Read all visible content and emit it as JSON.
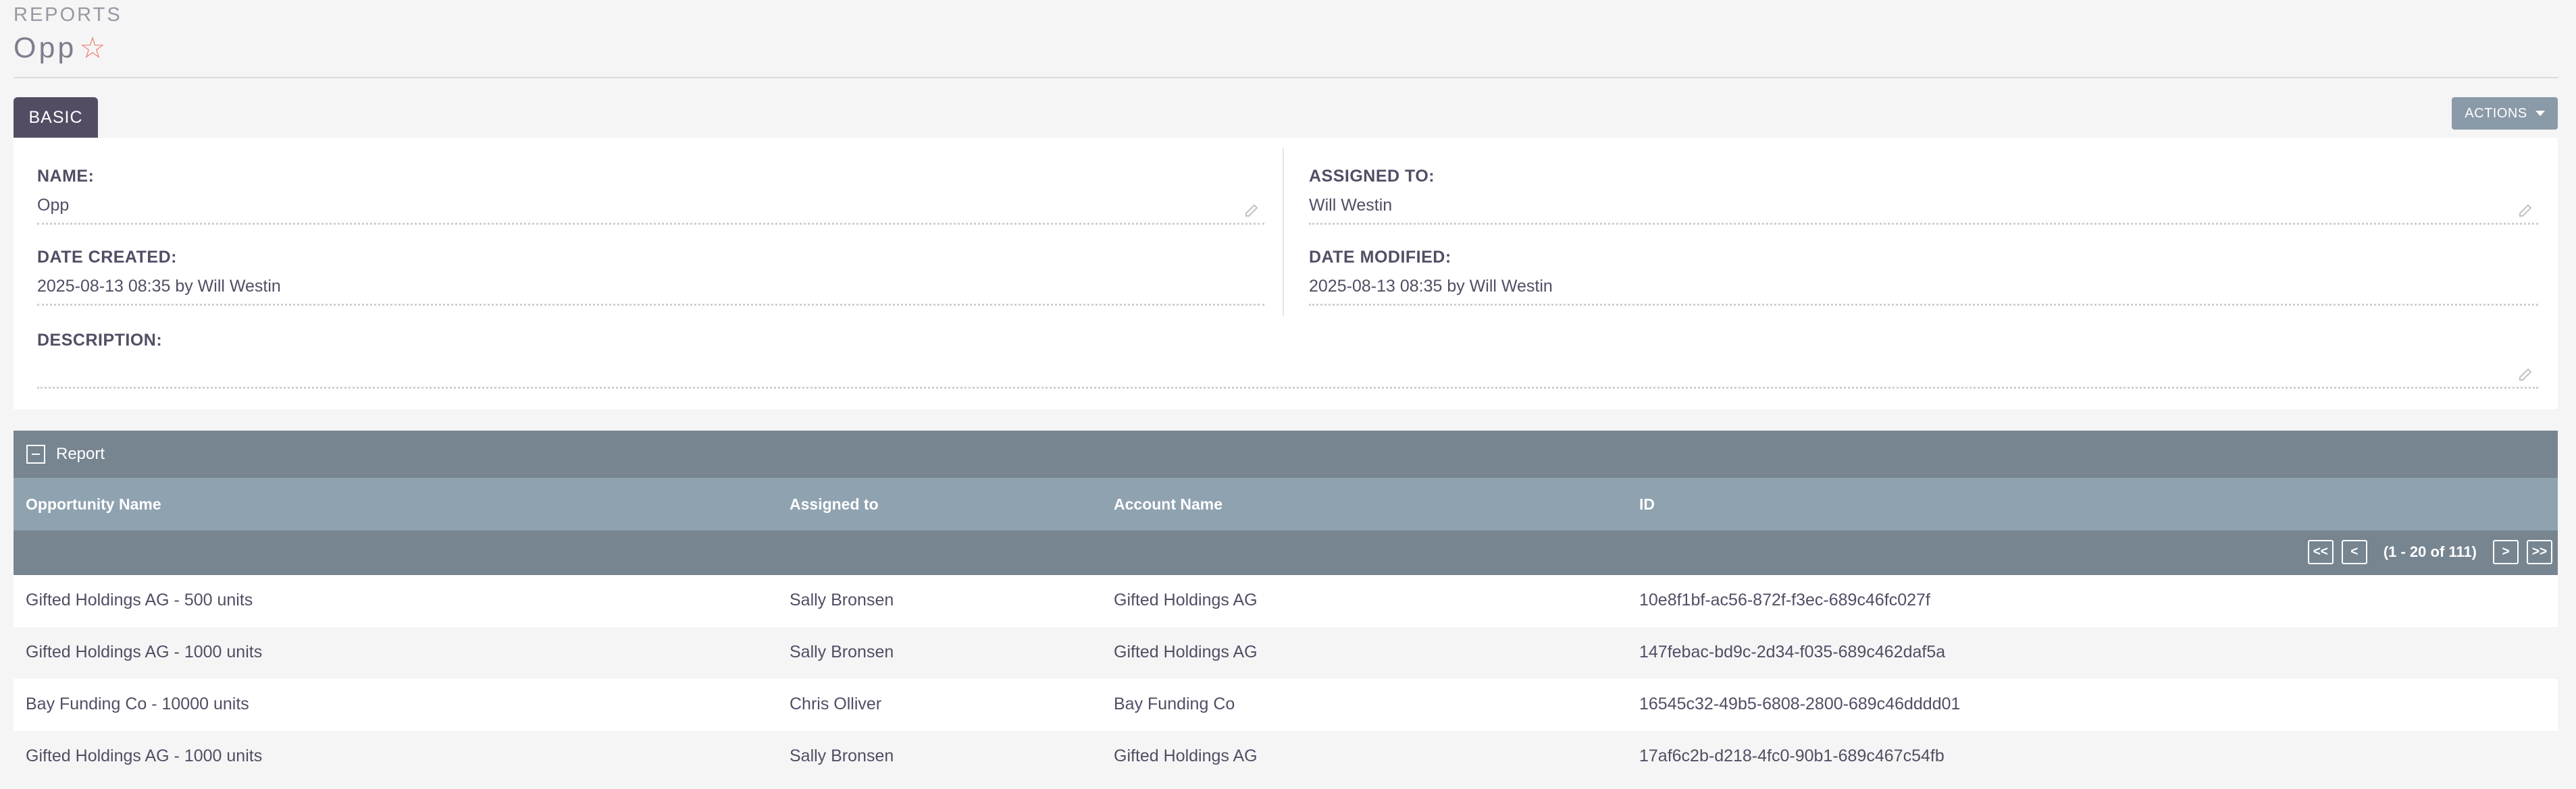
{
  "header": {
    "module": "REPORTS",
    "title": "Opp"
  },
  "tabs": {
    "basic": "BASIC"
  },
  "actions": {
    "label": "ACTIONS"
  },
  "fields": {
    "name": {
      "label": "NAME:",
      "value": "Opp"
    },
    "assigned_to": {
      "label": "ASSIGNED TO:",
      "value": "Will Westin"
    },
    "date_created": {
      "label": "DATE CREATED:",
      "value": "2025-08-13 08:35 by Will Westin"
    },
    "date_modified": {
      "label": "DATE MODIFIED:",
      "value": "2025-08-13 08:35 by Will Westin"
    },
    "description": {
      "label": "DESCRIPTION:",
      "value": ""
    }
  },
  "report": {
    "title": "Report",
    "columns": [
      "Opportunity Name",
      "Assigned to",
      "Account Name",
      "ID"
    ],
    "pager": {
      "first": "<<",
      "prev": "<",
      "count": "(1 - 20 of 111)",
      "next": ">",
      "last": ">>"
    },
    "rows": [
      [
        "Gifted Holdings AG - 500 units",
        "Sally Bronsen",
        "Gifted Holdings AG",
        "10e8f1bf-ac56-872f-f3ec-689c46fc027f"
      ],
      [
        "Gifted Holdings AG - 1000 units",
        "Sally Bronsen",
        "Gifted Holdings AG",
        "147febac-bd9c-2d34-f035-689c462daf5a"
      ],
      [
        "Bay Funding Co - 10000 units",
        "Chris Olliver",
        "Bay Funding Co",
        "16545c32-49b5-6808-2800-689c46dddd01"
      ],
      [
        "Gifted Holdings AG - 1000 units",
        "Sally Bronsen",
        "Gifted Holdings AG",
        "17af6c2b-d218-4fc0-90b1-689c467c54fb"
      ]
    ]
  },
  "colors": {
    "primary": "#534d64",
    "subpanel": "#778591",
    "column_header": "#8fa2b0",
    "star": "#f08377"
  }
}
